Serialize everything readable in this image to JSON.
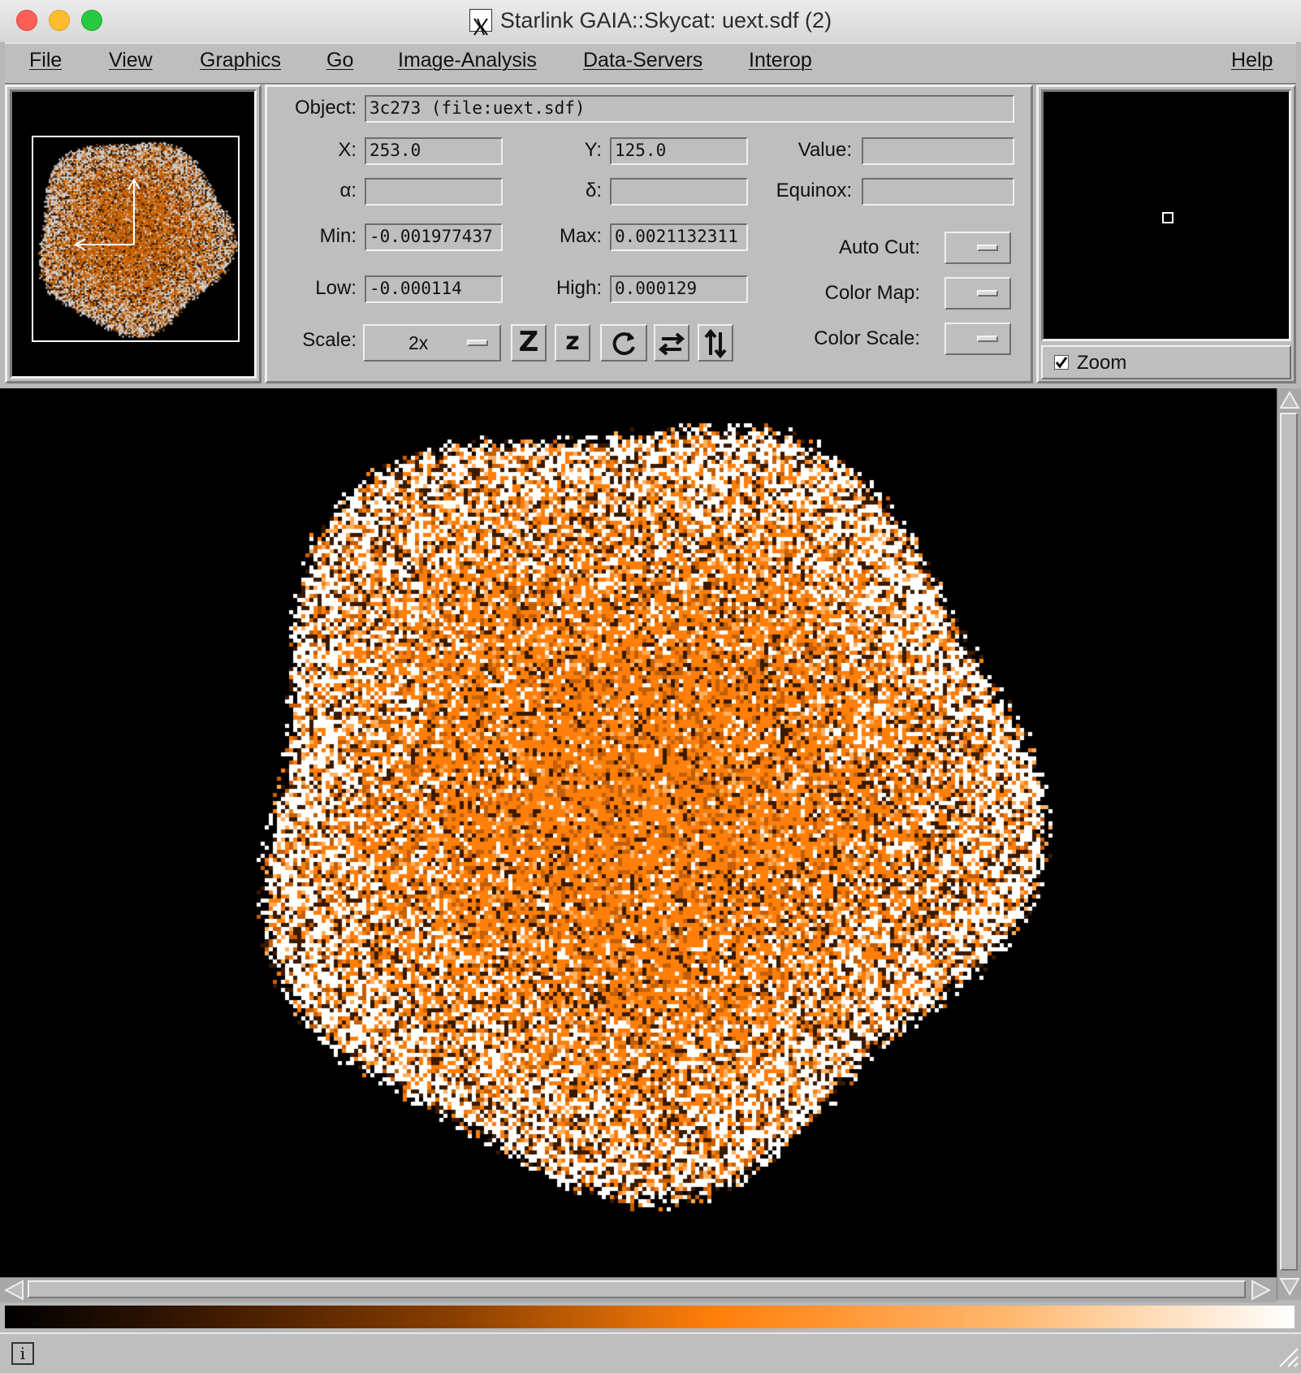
{
  "window": {
    "title": "Starlink GAIA::Skycat: uext.sdf (2)"
  },
  "menubar": {
    "items": [
      {
        "label": "File"
      },
      {
        "label": "View"
      },
      {
        "label": "Graphics"
      },
      {
        "label": "Go"
      },
      {
        "label": "Image-Analysis"
      },
      {
        "label": "Data-Servers"
      },
      {
        "label": "Interop"
      },
      {
        "label": "Help"
      }
    ]
  },
  "info_panel": {
    "object_label": "Object:",
    "object_value": "3c273 (file:uext.sdf)",
    "x_label": "X:",
    "x_value": "253.0",
    "y_label": "Y:",
    "y_value": "125.0",
    "value_label": "Value:",
    "value_value": "",
    "alpha_label": "α:",
    "alpha_value": "",
    "delta_label": "δ:",
    "delta_value": "",
    "equinox_label": "Equinox:",
    "equinox_value": "",
    "min_label": "Min:",
    "min_value": "-0.001977437",
    "max_label": "Max:",
    "max_value": "0.0021132311",
    "low_label": "Low:",
    "low_value": "-0.000114",
    "high_label": "High:",
    "high_value": "0.000129",
    "autocut_label": "Auto Cut:",
    "colormap_label": "Color Map:",
    "colorscale_label": "Color Scale:",
    "scale_label": "Scale:",
    "scale_value": "2x"
  },
  "toolbar": {
    "zoom_in_glyph": "Z",
    "zoom_out_glyph": "z",
    "rotate_icon": "rotate-icon",
    "flip_x_icon": "flip-horizontal-icon",
    "flip_y_icon": "flip-vertical-icon"
  },
  "zoom_panel": {
    "checkbox_label": "Zoom",
    "checked": true
  },
  "colors": {
    "image_orange": "#ff7f0a",
    "panel_gray": "#bebebe"
  }
}
